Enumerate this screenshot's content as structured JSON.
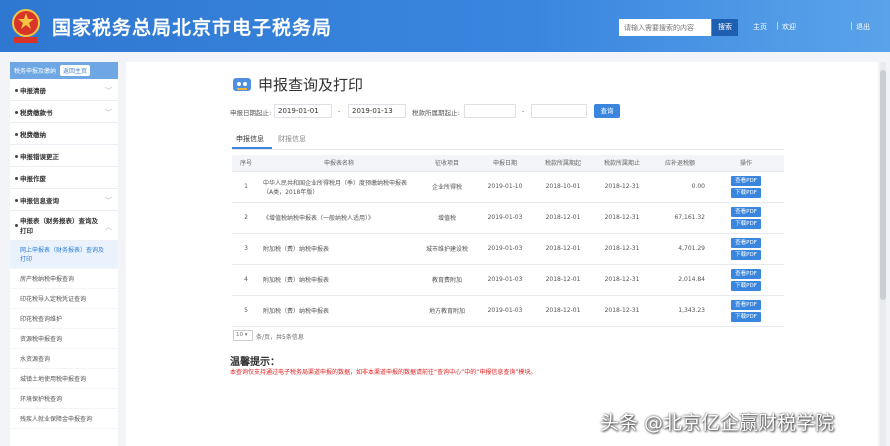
{
  "header": {
    "site_title": "国家税务总局北京市电子税务局",
    "search_placeholder": "请输入需要搜索的内容",
    "search_button": "搜索",
    "links": [
      "主页",
      "欢迎",
      "退出"
    ]
  },
  "sidebar": {
    "top_label": "税务申报及缴纳",
    "return_button": "返回主页",
    "items": [
      {
        "label": "申报清册",
        "has_chevron": true
      },
      {
        "label": "税费缴款书",
        "has_chevron": true
      },
      {
        "label": "税费缴纳",
        "has_chevron": false
      },
      {
        "label": "申报错误更正",
        "has_chevron": false
      },
      {
        "label": "申报作废",
        "has_chevron": false
      },
      {
        "label": "申报信息查询",
        "has_chevron": true
      }
    ],
    "expanded_item": "申报表（财务报表）查询及打印",
    "sub_items": [
      {
        "label": "网上申报表（财务报表）查询及打印",
        "active": true
      },
      {
        "label": "房产税纳税申报查询",
        "active": false
      },
      {
        "label": "印花税导入定税凭证查询",
        "active": false
      },
      {
        "label": "印花税查询维护",
        "active": false
      },
      {
        "label": "资源税申报查询",
        "active": false
      },
      {
        "label": "水资源查询",
        "active": false
      },
      {
        "label": "城镇土地使用税申报查询",
        "active": false
      },
      {
        "label": "环境保护税查询",
        "active": false
      },
      {
        "label": "残疾人就业保障金申报查询",
        "active": false
      }
    ]
  },
  "main": {
    "page_title": "申报查询及打印",
    "filters": {
      "date_label": "申报日期起止:",
      "date_from": "2019-01-01",
      "date_dash": "-",
      "date_to": "2019-01-13",
      "period_label": "税款所属期起止:",
      "period_from": "",
      "period_dash": "-",
      "period_to": "",
      "query_button": "查询"
    },
    "tabs": [
      {
        "label": "申报信息",
        "active": true
      },
      {
        "label": "财报信息",
        "active": false
      }
    ],
    "table": {
      "headers": [
        "序号",
        "申报表名称",
        "征收项目",
        "申报日期",
        "税款所属期起",
        "税款所属期止",
        "应补退税额",
        "操作"
      ],
      "rows": [
        {
          "no": "1",
          "name": "中华人民共和国企业所得税月（季）度预缴纳税申报表（A类，2018年版）",
          "item": "企业所得税",
          "date": "2019-01-10",
          "from": "2018-10-01",
          "to": "2018-12-31",
          "amount": "0.00"
        },
        {
          "no": "2",
          "name": "《增值税纳税申报表（一般纳税人适用）》",
          "item": "增值税",
          "date": "2019-01-03",
          "from": "2018-12-01",
          "to": "2018-12-31",
          "amount": "67,161.32"
        },
        {
          "no": "3",
          "name": "附加税（费）纳税申报表",
          "item": "城市维护建设税",
          "date": "2019-01-03",
          "from": "2018-12-01",
          "to": "2018-12-31",
          "amount": "4,701.29"
        },
        {
          "no": "4",
          "name": "附加税（费）纳税申报表",
          "item": "教育费附加",
          "date": "2019-01-03",
          "from": "2018-12-01",
          "to": "2018-12-31",
          "amount": "2,014.84"
        },
        {
          "no": "5",
          "name": "附加税（费）纳税申报表",
          "item": "地方教育附加",
          "date": "2019-01-03",
          "from": "2018-12-01",
          "to": "2018-12-31",
          "amount": "1,343.23"
        }
      ],
      "op_view": "查看PDF",
      "op_download": "下载PDF"
    },
    "pager": {
      "page_size": "10",
      "summary": "条/页，共5条信息"
    },
    "tips": {
      "title": "温馨提示：",
      "text": "本查询仅支持通过电子税务局渠道申报的数据，如非本渠道申报的数据请前往“查询中心”中的“申报信息查询”模块。"
    }
  },
  "watermark": "头条 @北京亿企赢财税学院",
  "colors": {
    "header_blue": "#3a86df",
    "accent": "#3a86df",
    "tip_red": "#e02020"
  }
}
